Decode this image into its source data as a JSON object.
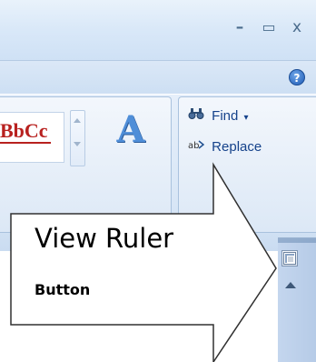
{
  "window": {
    "controls": {
      "minimize": "–",
      "maximize": "▭",
      "close": "x"
    },
    "help": "?"
  },
  "ribbon": {
    "styles_group": {
      "sample_text": "BbCc",
      "change_styles_glyph": "A"
    },
    "editing_group": {
      "find_label": "Find",
      "find_icon": "binoculars-icon",
      "replace_label": "Replace",
      "replace_icon": "replace-icon"
    }
  },
  "callout": {
    "title": "View Ruler",
    "subtitle": "Button"
  },
  "scrollbar": {
    "ruler_button": "view-ruler-icon",
    "scroll_up": "arrow-up-icon"
  }
}
